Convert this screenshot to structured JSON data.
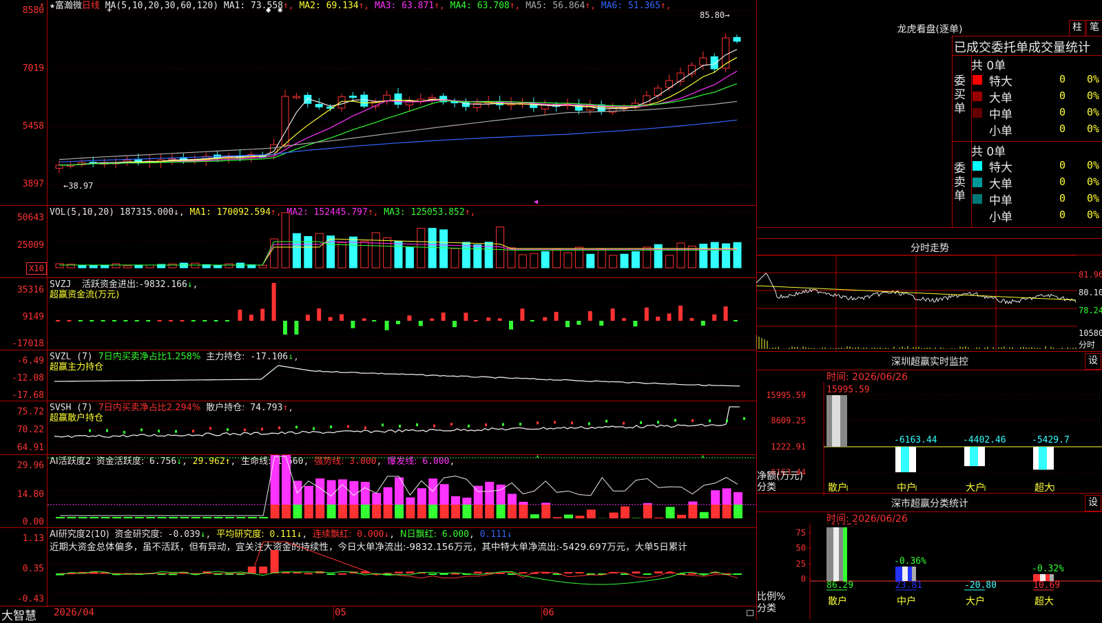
{
  "stock": {
    "star": "★",
    "name": "富瀚微",
    "period": "日线"
  },
  "main": {
    "ma_params": "MA(5,10,20,30,60,120)",
    "ma": [
      {
        "label": "MA1:",
        "value": "73.558",
        "arrow": "↑",
        "color": "#e8e8e8"
      },
      {
        "label": "MA2:",
        "value": "69.134",
        "arrow": "↑",
        "color": "#ffff33"
      },
      {
        "label": "MA3:",
        "value": "63.871",
        "arrow": "↑",
        "color": "#ff33ff"
      },
      {
        "label": "MA4:",
        "value": "63.708",
        "arrow": "↑",
        "color": "#33ff33"
      },
      {
        "label": "MA5:",
        "value": "56.864",
        "arrow": "↑",
        "color": "#aaaaaa"
      },
      {
        "label": "MA6:",
        "value": "51.365",
        "arrow": "↑",
        "color": "#3366ff"
      }
    ],
    "yticks": [
      "8580",
      "7019",
      "5458",
      "3897"
    ],
    "high_label": "85.80",
    "low_label": "38.97",
    "high_arrow": "→",
    "low_arrow": "←"
  },
  "vol": {
    "params": "VOL(5,10,20)",
    "value": "187315.000",
    "arrow": "↓",
    "ma": [
      {
        "label": "MA1:",
        "value": "170092.594",
        "arrow": "↑",
        "color": "#ffff33"
      },
      {
        "label": "MA2:",
        "value": "152445.797",
        "arrow": "↑",
        "color": "#ff33ff"
      },
      {
        "label": "MA3:",
        "value": "125053.852",
        "arrow": "↑",
        "color": "#33ff33"
      }
    ],
    "yticks": [
      "50643",
      "25009"
    ],
    "unit": "X10"
  },
  "svzj": {
    "name": "SVZJ",
    "desc": "活跃资金进出:",
    "value": "-9832.166",
    "arrow": "↓",
    "sub": "超赢资金流(万元)",
    "yticks": [
      "35316",
      "9149",
      "-17018"
    ]
  },
  "svzl": {
    "name": "SVZL",
    "param": "(7)",
    "desc": "7日内买卖净占比1.258%",
    "desc2": "主力持仓:",
    "value": "-17.106",
    "arrow": "↓",
    "sub": "超赢主力持仓",
    "yticks": [
      "-6.49",
      "-12.08",
      "-17.68"
    ]
  },
  "svsh": {
    "name": "SVSH",
    "param": "(7)",
    "desc": "7日内买卖净占比2.294%",
    "desc2": "散户持仓:",
    "value": "74.793",
    "arrow": "↑",
    "sub": "超赢散户持仓",
    "yticks": [
      "75.72",
      "70.22",
      "64.91"
    ]
  },
  "ai1": {
    "name": "AI活跃度2",
    "desc": "资金活跃度:",
    "value": "6.756",
    "arrow": "↓",
    "v2": "29.962",
    "desc3": "生命线:",
    "v3": "1.560",
    "desc4": "强势线:",
    "v4": "3.000",
    "desc5": "爆发线:",
    "v5": "6.000",
    "yticks": [
      "29.96",
      "14.80",
      "0.00"
    ]
  },
  "ai2": {
    "name": "AI研究度2(10)",
    "desc": "资金研究度:",
    "value": "-0.039",
    "arrow": "↓",
    "desc2": "平均研究度:",
    "v2": "0.111",
    "desc3": "连续飘红:",
    "v3": "0.000",
    "desc4": "N日飘红:",
    "v4": "6.000",
    "v5": "0.111",
    "comment": "近期大资金总体偏多，虽不活跃，但有异动，宜关注大资金的持续性，今日大单净流出:-9832.156万元，其中特大单净流出:-5429.697万元，大单5日累计",
    "yticks": [
      "1.13",
      "0.35",
      "-0.43"
    ]
  },
  "footer": {
    "brand": "大智慧",
    "date": "2026/04",
    "m1": "05",
    "m2": "06"
  },
  "lhb": {
    "title": "龙虎看盘(逐单)",
    "btn1": "柱",
    "btn2": "笔",
    "subtitle": "已成交委托单成交量统计",
    "buy_label": "委买单",
    "sell_label": "委卖单",
    "buy_total": "共 0单",
    "sell_total": "共 0单",
    "buy_rows": [
      {
        "name": "特大",
        "v": "0",
        "p": "0%",
        "color": "#ff0000"
      },
      {
        "name": "大单",
        "v": "0",
        "p": "0%",
        "color": "#990000"
      },
      {
        "name": "中单",
        "v": "0",
        "p": "0%",
        "color": "#660000"
      },
      {
        "name": "小单",
        "v": "0",
        "p": "0%",
        "color": ""
      }
    ],
    "sell_rows": [
      {
        "name": "特大",
        "v": "0",
        "p": "0%",
        "color": "#00ffff"
      },
      {
        "name": "大单",
        "v": "0",
        "p": "0%",
        "color": "#009999"
      },
      {
        "name": "中单",
        "v": "0",
        "p": "0%",
        "color": "#007777"
      },
      {
        "name": "小单",
        "v": "0",
        "p": "0%",
        "color": ""
      }
    ]
  },
  "fs": {
    "title": "分时走势",
    "yticks": [
      "81.96",
      "80.10",
      "78.24",
      "10580"
    ],
    "unit": "分时"
  },
  "sz_monitor": {
    "title": "深圳超赢实时监控",
    "btn": "设",
    "time": "时间: 2026/06/26",
    "yticks": [
      "15995.59",
      "8609.25",
      "1222.91",
      "-6163.44"
    ],
    "ylabel": "净额(万元)",
    "xlabel": "分类",
    "cats": [
      "散户",
      "中户",
      "大户",
      "超大"
    ],
    "values": [
      15995.59,
      -6163.44,
      -4402.46,
      -5429.7
    ],
    "value_labels": [
      "15995.59",
      "-6163.44",
      "-4402.46",
      "-5429.7"
    ]
  },
  "sz_class": {
    "title": "深市超赢分类统计",
    "btn": "设",
    "time": "时间: 2026/06/26",
    "yticks": [
      "75",
      "50",
      "25",
      "0"
    ],
    "ylabel": "比例%",
    "xlabel": "分类",
    "cats": [
      "散户",
      "中户",
      "大户",
      "超大"
    ],
    "pct": [
      "+0.93%",
      "-0.36%",
      "",
      "-0.32%"
    ],
    "values": [
      86.29,
      23.81,
      -20.8,
      10.69
    ],
    "value_labels": [
      "86.29",
      "23.81",
      "-20.80",
      "10.69"
    ]
  }
}
